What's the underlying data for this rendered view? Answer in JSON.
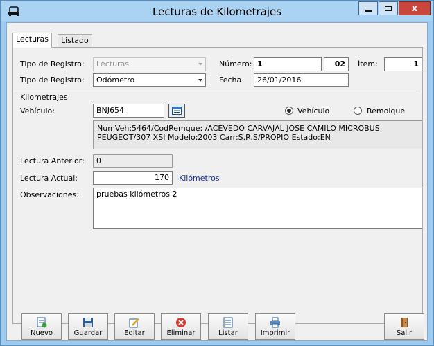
{
  "window": {
    "title": "Lecturas de Kilometrajes",
    "minimize_icon": "minimize-icon",
    "maximize_icon": "maximize-icon",
    "close_label": "x"
  },
  "tabs": [
    {
      "label": "Lecturas",
      "active": true
    },
    {
      "label": "Listado",
      "active": false
    }
  ],
  "form": {
    "tipo_registro_1": {
      "label": "Tipo de Registro:",
      "value": "Lecturas"
    },
    "tipo_registro_2": {
      "label": "Tipo de Registro:",
      "value": "Odómetro"
    },
    "numero": {
      "label": "Número:",
      "value": "1",
      "suffix": "02"
    },
    "item": {
      "label": "Ítem:",
      "value": "1"
    },
    "fecha": {
      "label": "Fecha",
      "value": "26/01/2016"
    }
  },
  "kilometrajes": {
    "group_label": "Kilometrajes",
    "vehiculo": {
      "label": "Vehículo:",
      "value": "BNJ654"
    },
    "radio_vehiculo": {
      "label": "Vehículo",
      "checked": true
    },
    "radio_remolque": {
      "label": "Remolque",
      "checked": false
    },
    "info_line1": "NumVeh:5464/CodRemque:  /ACEVEDO CARVAJAL JOSE CAMILO MICROBUS",
    "info_line2": "PEUGEOT/307 XSI Modelo:2003 Carr:S.R.S/PROPIO Estado:EN",
    "lectura_anterior": {
      "label": "Lectura Anterior:",
      "value": "0"
    },
    "lectura_actual": {
      "label": "Lectura Actual:",
      "value": "170",
      "units": "Kilómetros"
    },
    "observaciones": {
      "label": "Observaciones:",
      "value": "pruebas kilómetros 2"
    }
  },
  "toolbar": {
    "nuevo": "Nuevo",
    "guardar": "Guardar",
    "editar": "Editar",
    "eliminar": "Eliminar",
    "listar": "Listar",
    "imprimir": "Imprimir",
    "salir": "Salir"
  },
  "colors": {
    "title_bar": "#a9d2f3",
    "close_button": "#c9463d",
    "units_text": "#1a2f9b"
  }
}
